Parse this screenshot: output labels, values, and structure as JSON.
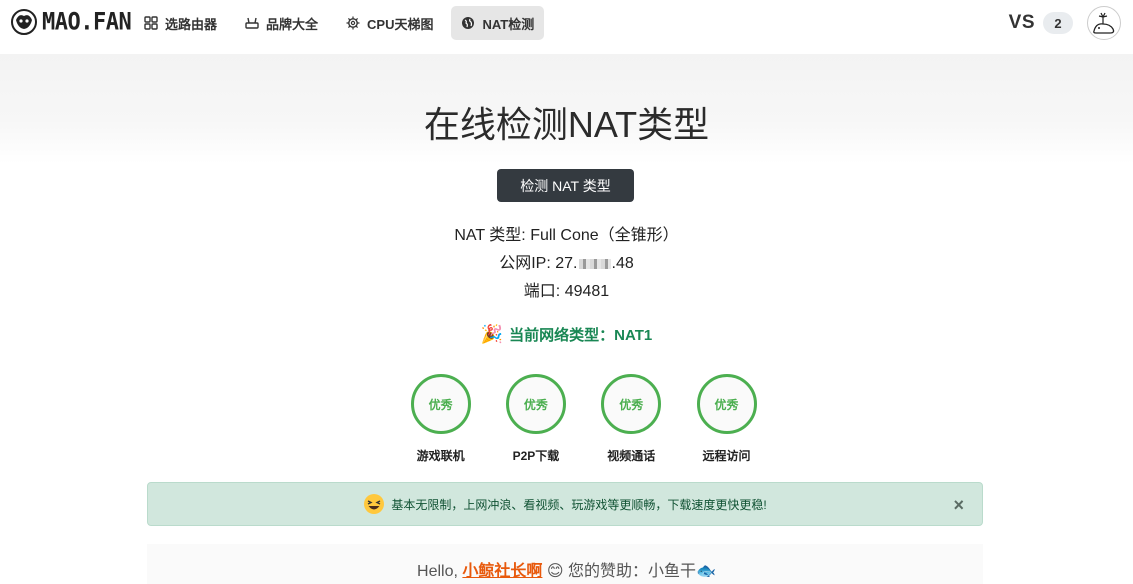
{
  "header": {
    "logo_text": "MAO.FAN",
    "nav": [
      {
        "label": "选路由器",
        "icon": "grid-icon"
      },
      {
        "label": "品牌大全",
        "icon": "router-icon"
      },
      {
        "label": "CPU天梯图",
        "icon": "cpu-icon"
      },
      {
        "label": "NAT检测",
        "icon": "globe-icon",
        "active": true
      }
    ],
    "vs_label": "VS",
    "vs_count": "2"
  },
  "page_title": "在线检测NAT类型",
  "detect_button": "检测 NAT 类型",
  "results": {
    "nat_type": "NAT 类型: Full Cone（全锥形）",
    "ip_prefix": "公网IP: 27.",
    "ip_suffix": ".48",
    "port": "端口: 49481",
    "current_type": "当前网络类型：NAT1"
  },
  "scores": [
    {
      "rating": "优秀",
      "label": "游戏联机"
    },
    {
      "rating": "优秀",
      "label": "P2P下载"
    },
    {
      "rating": "优秀",
      "label": "视频通话"
    },
    {
      "rating": "优秀",
      "label": "远程访问"
    }
  ],
  "alert": {
    "text": "基本无限制，上网冲浪、看视频、玩游戏等更顺畅，下载速度更快更稳!",
    "close": "×"
  },
  "footer": {
    "hello": "Hello, ",
    "user": "小鲸社长啊",
    "smile": "😊",
    "sponsor": " 您的赞助：小鱼干🐟"
  },
  "colors": {
    "accent_green": "#4caf50",
    "success_text": "#198754",
    "button_dark": "#343a40",
    "link_orange": "#e8590c"
  }
}
